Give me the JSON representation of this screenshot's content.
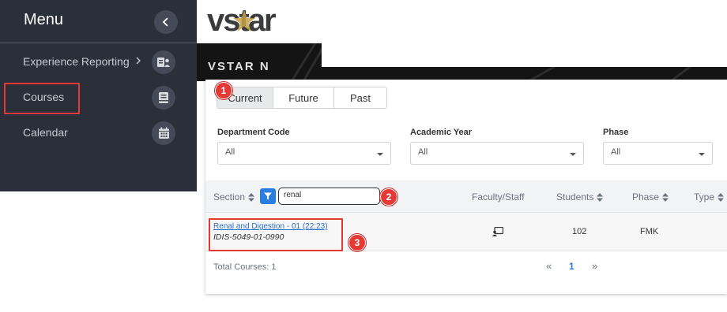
{
  "sidebar": {
    "title": "Menu",
    "collapse_icon": "chevron-left-icon",
    "items": [
      {
        "label": "Experience Reporting",
        "icon": "person-report-icon",
        "has_chevron": true
      },
      {
        "label": "Courses",
        "icon": "book-icon",
        "highlighted": true
      },
      {
        "label": "Calendar",
        "icon": "calendar-icon"
      }
    ]
  },
  "logo": {
    "text": "vstar"
  },
  "banner": {
    "text": "VSTAR N"
  },
  "tabs": [
    {
      "label": "Current",
      "active": true
    },
    {
      "label": "Future"
    },
    {
      "label": "Past"
    }
  ],
  "filters": [
    {
      "label": "Department Code",
      "value": "All"
    },
    {
      "label": "Academic Year",
      "value": "All"
    },
    {
      "label": "Phase",
      "value": "All"
    }
  ],
  "table": {
    "columns": {
      "section": "Section",
      "faculty": "Faculty/Staff",
      "students": "Students",
      "phase": "Phase",
      "type": "Type"
    },
    "search_value": "renal",
    "rows": [
      {
        "course_name": "Renal and Digestion - 01 (22:23)",
        "course_code": "IDIS-5049-01-0990",
        "faculty_icon": "presenter-icon",
        "students": "102",
        "phase": "FMK"
      }
    ],
    "total": "Total Courses: 1"
  },
  "pagination": {
    "prev": "«",
    "page": "1",
    "next": "»"
  },
  "annotations": [
    "1",
    "2",
    "3"
  ],
  "colors": {
    "sidebar_bg": "#2b2f3a",
    "accent": "#2a7de1",
    "annotation": "#e53935",
    "logo_star": "#c8a24a"
  }
}
